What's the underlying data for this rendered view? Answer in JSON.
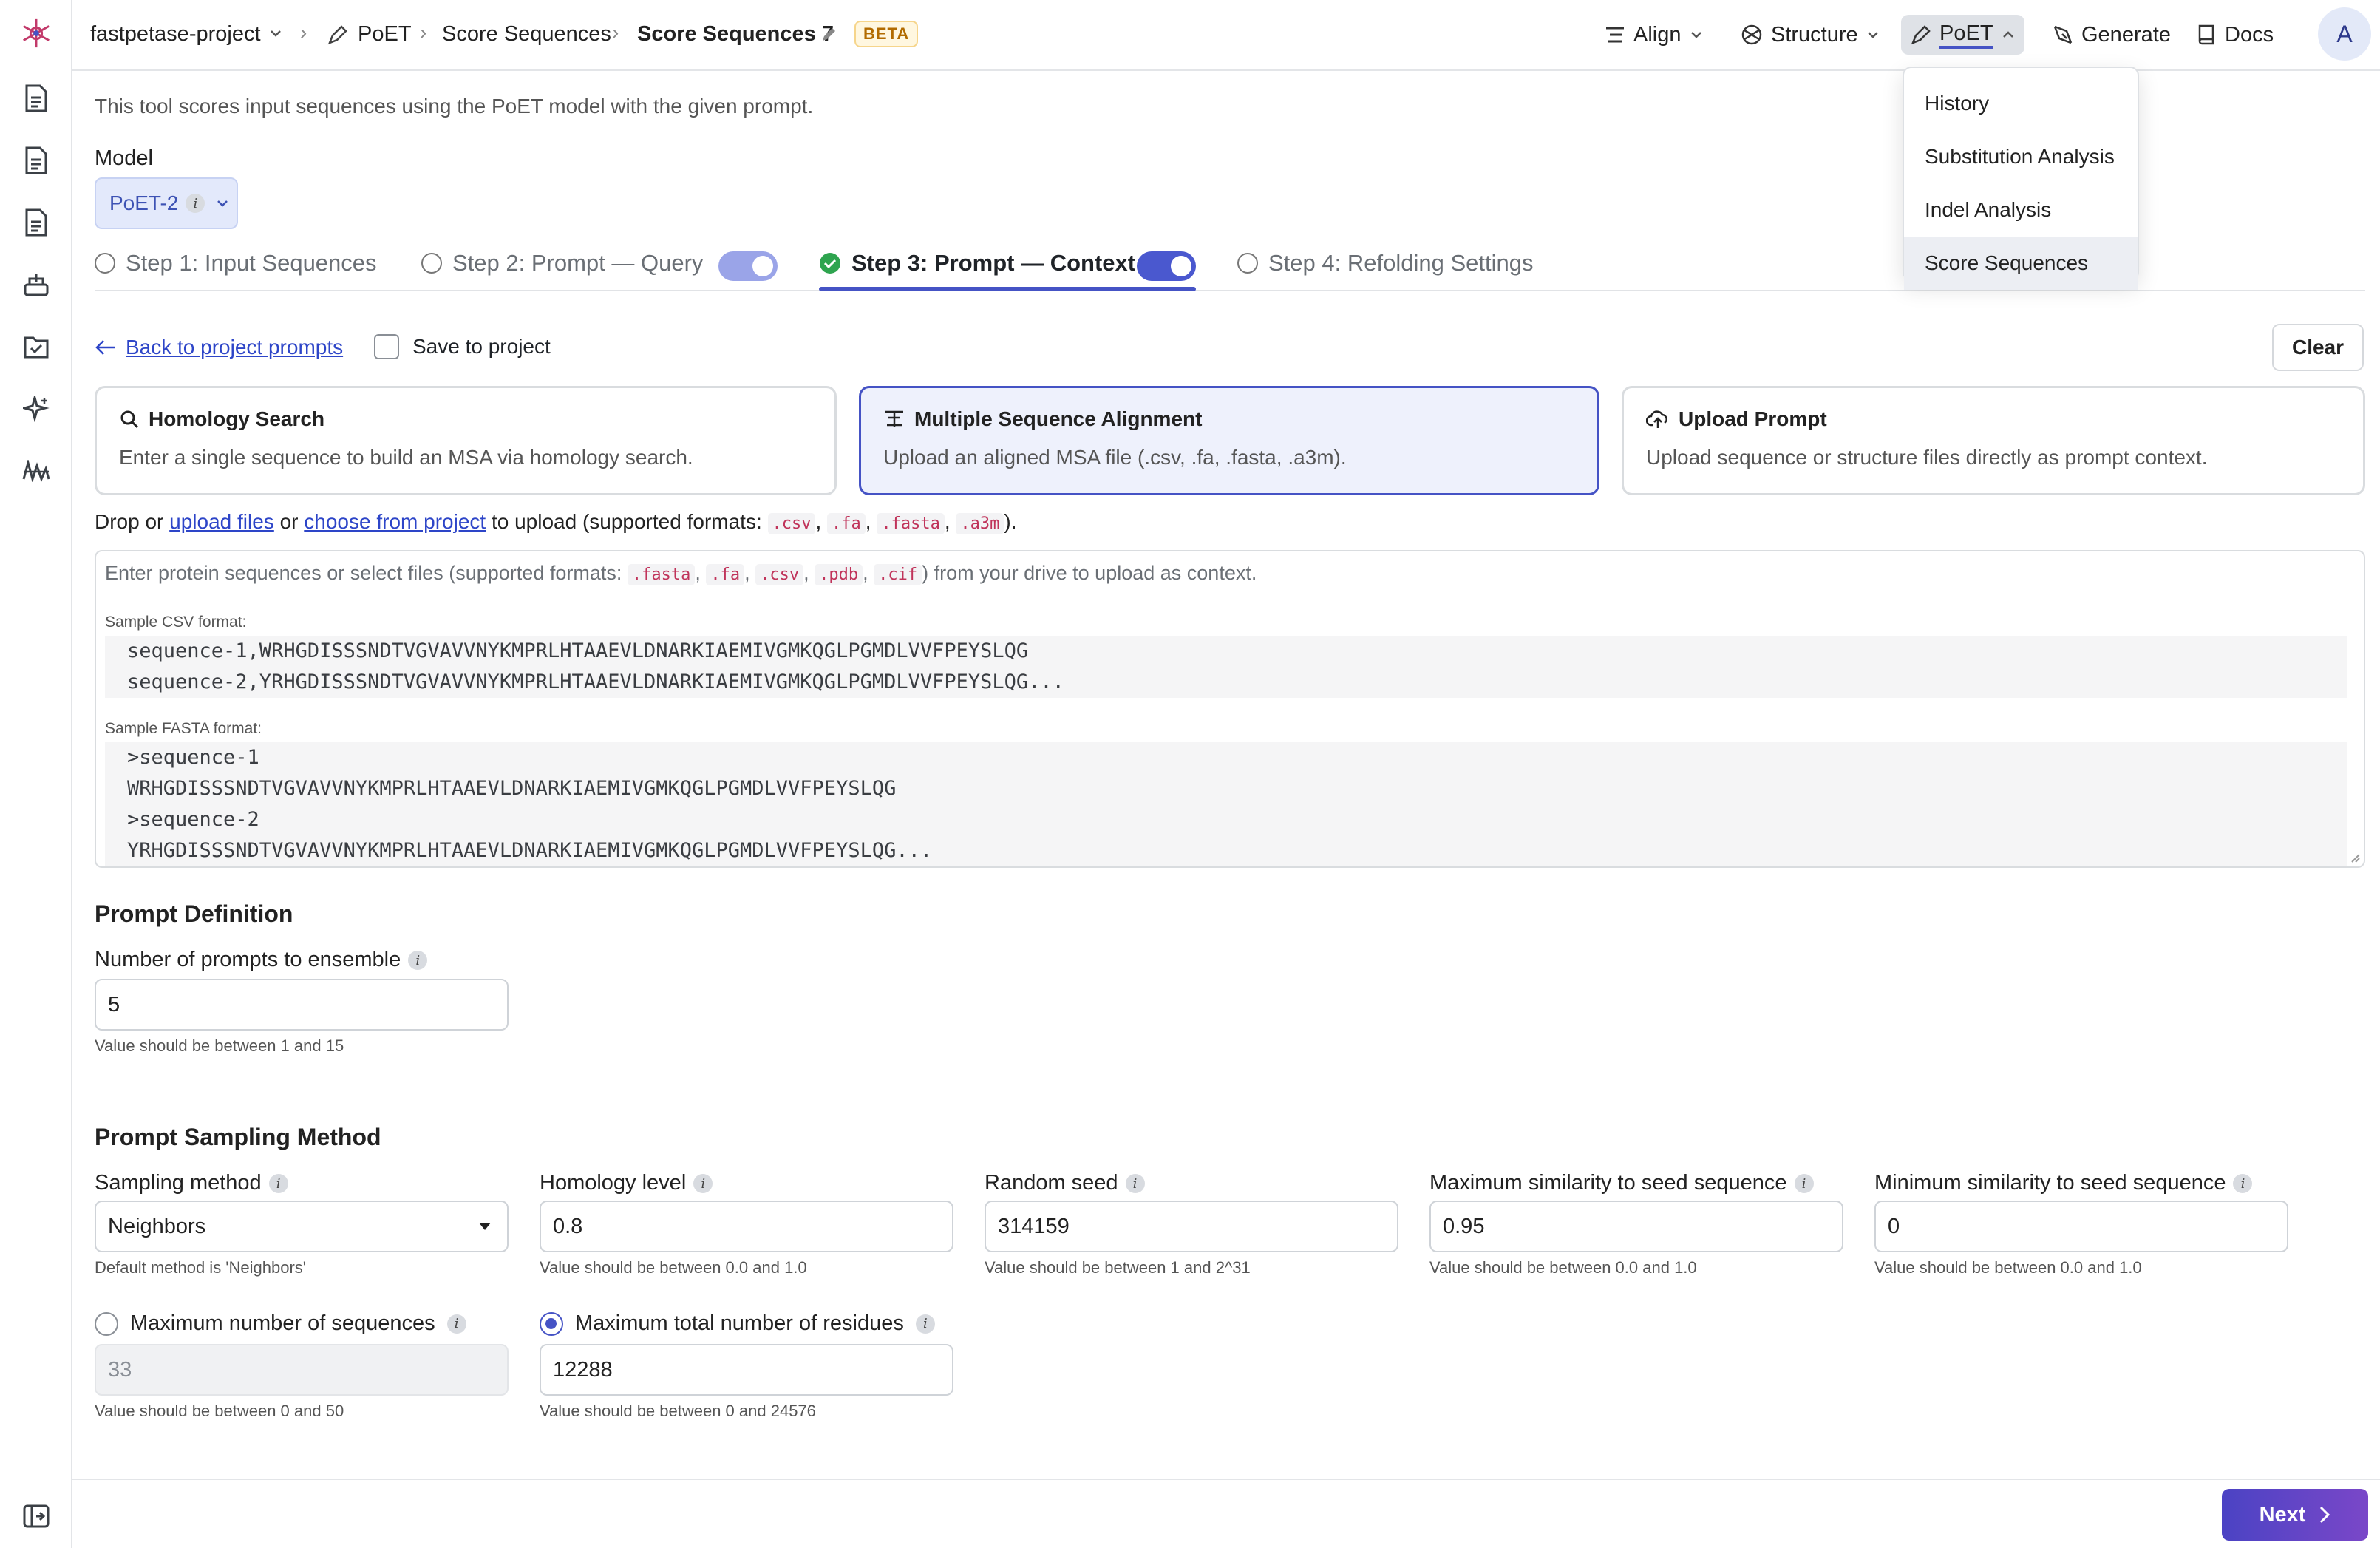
{
  "topbar": {
    "project": "fastpetase-project",
    "breadcrumb": [
      "PoET",
      "Score Sequences",
      "Score Sequences 7"
    ],
    "beta": "BETA",
    "nav": [
      "Align",
      "Structure",
      "PoET",
      "Generate",
      "Docs"
    ],
    "avatar": "A"
  },
  "poet_menu": [
    "History",
    "Substitution Analysis",
    "Indel Analysis",
    "Score Sequences"
  ],
  "description": "This tool scores input sequences using the PoET model with the given prompt.",
  "model": {
    "label": "Model",
    "value": "PoET-2"
  },
  "steps": [
    {
      "label": "Step 1: Input Sequences"
    },
    {
      "label": "Step 2: Prompt — Query"
    },
    {
      "label": "Step 3: Prompt — Context"
    },
    {
      "label": "Step 4: Refolding Settings"
    }
  ],
  "back_link": "Back to project prompts",
  "save_to_project": "Save to project",
  "clear": "Clear",
  "cards": [
    {
      "title": "Homology Search",
      "desc": "Enter a single sequence to build an MSA via homology search."
    },
    {
      "title": "Multiple Sequence Alignment",
      "desc": "Upload an aligned MSA file (.csv, .fa, .fasta, .a3m)."
    },
    {
      "title": "Upload Prompt",
      "desc": "Upload sequence or structure files directly as prompt context."
    }
  ],
  "drop": {
    "t1": "Drop or",
    "upload_files": "upload files",
    "or": "or",
    "choose": "choose from project",
    "t2": "to upload (supported formats:",
    "formats": [
      ".csv",
      ".fa",
      ".fasta",
      ".a3m"
    ],
    "t3": ")."
  },
  "textarea": {
    "placeholder_a": "Enter protein sequences or select files (supported formats:",
    "formats": [
      ".fasta",
      ".fa",
      ".csv",
      ".pdb",
      ".cif"
    ],
    "placeholder_b": ") from your drive to upload as context.",
    "csv_label": "Sample CSV format:",
    "csv_lines": [
      "sequence-1,WRHGDISSSNDTVGVAVVNYKMPRLHTAAEVLDNARKIAEMIVGMKQGLPGMDLVVFPEYSLQG",
      "sequence-2,YRHGDISSSNDTVGVAVVNYKMPRLHTAAEVLDNARKIAEMIVGMKQGLPGMDLVVFPEYSLQG..."
    ],
    "fasta_label": "Sample FASTA format:",
    "fasta_lines": [
      ">sequence-1",
      "WRHGDISSSNDTVGVAVVNYKMPRLHTAAEVLDNARKIAEMIVGMKQGLPGMDLVVFPEYSLQG",
      ">sequence-2",
      "YRHGDISSSNDTVGVAVVNYKMPRLHTAAEVLDNARKIAEMIVGMKQGLPGMDLVVFPEYSLQG..."
    ]
  },
  "prompt_definition": {
    "title": "Prompt Definition",
    "ensemble_label": "Number of prompts to ensemble",
    "ensemble_value": "5",
    "ensemble_hint": "Value should be between 1 and 15"
  },
  "sampling": {
    "title": "Prompt Sampling Method",
    "method_label": "Sampling method",
    "method_value": "Neighbors",
    "method_hint": "Default method is 'Neighbors'",
    "homology_label": "Homology level",
    "homology_value": "0.8",
    "homology_hint": "Value should be between 0.0 and 1.0",
    "seed_label": "Random seed",
    "seed_value": "314159",
    "seed_hint": "Value should be between 1 and 2^31",
    "maxsim_label": "Maximum similarity to seed sequence",
    "maxsim_value": "0.95",
    "maxsim_hint": "Value should be between 0.0 and 1.0",
    "minsim_label": "Minimum similarity to seed sequence",
    "minsim_value": "0",
    "minsim_hint": "Value should be between 0.0 and 1.0",
    "maxseq_label": "Maximum number of sequences",
    "maxseq_value": "33",
    "maxseq_hint": "Value should be between 0 and 50",
    "maxres_label": "Maximum total number of residues",
    "maxres_value": "12288",
    "maxres_hint": "Value should be between 0 and 24576"
  },
  "next": "Next",
  "colors": {
    "accent": "#4553c5",
    "success": "#2ea44f"
  }
}
